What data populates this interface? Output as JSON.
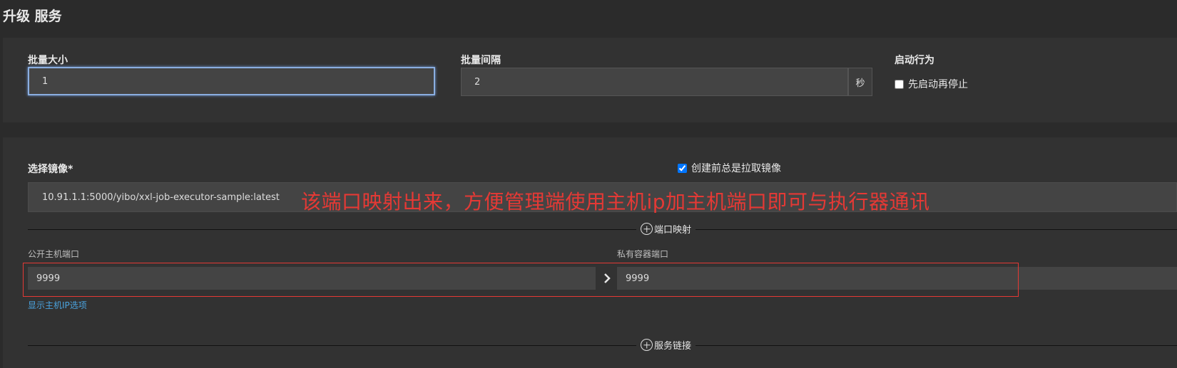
{
  "page": {
    "title": "升级 服务"
  },
  "upgrade": {
    "batch_size_label": "批量大小",
    "batch_size_value": "1",
    "batch_interval_label": "批量间隔",
    "batch_interval_value": "2",
    "batch_interval_unit": "秒",
    "start_behavior_label": "启动行为",
    "start_first_label": "先启动再停止",
    "start_first_checked": false
  },
  "image": {
    "label": "选择镜像*",
    "value": "10.91.1.1:5000/yibo/xxl-job-executor-sample:latest",
    "always_pull_label": "创建前总是拉取镜像",
    "always_pull_checked": true
  },
  "annotation": {
    "text": "该端口映射出来，方便管理端使用主机ip加主机端口即可与执行器通讯",
    "color": "#e53935"
  },
  "port_mapping": {
    "section_label": "端口映射",
    "public_port_label": "公开主机端口",
    "public_port_value": "9999",
    "private_port_label": "私有容器端口",
    "private_port_value": "9999",
    "show_host_ip_link": "显示主机IP选项"
  },
  "service_links": {
    "section_label": "服务链接"
  },
  "icons": {
    "add_section": "plus-circle-icon",
    "mapping_arrow": "chevron-right-icon",
    "checkbox": "checkbox-icon"
  },
  "colors": {
    "background": "#2b2b2b",
    "panel": "#323232",
    "link": "#4aa3df",
    "annotation": "#e53935",
    "focus": "#8aaee0"
  }
}
